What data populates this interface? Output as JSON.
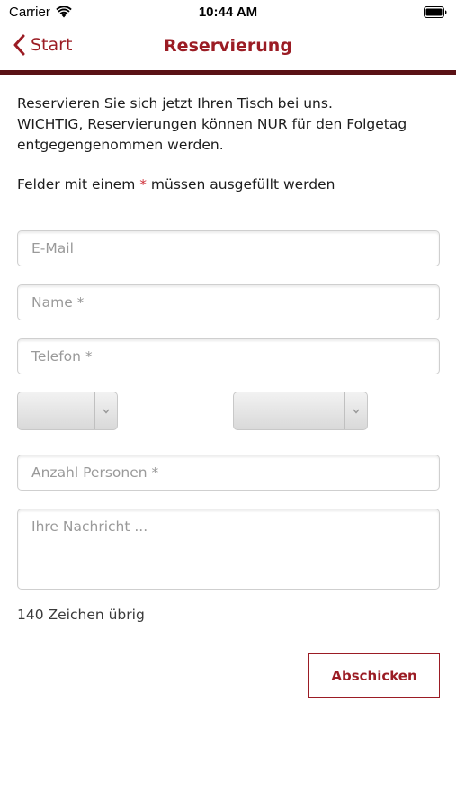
{
  "status_bar": {
    "carrier": "Carrier",
    "time": "10:44 AM"
  },
  "nav": {
    "back_label": "Start",
    "title": "Reservierung"
  },
  "content": {
    "intro_line1": "Reservieren Sie sich jetzt Ihren Tisch bei uns.",
    "intro_line2": "WICHTIG, Reservierungen können NUR für den Folgetag entgegengenommen werden.",
    "required_prefix": "Felder mit einem",
    "required_star": "*",
    "required_suffix": "müssen ausgefüllt werden"
  },
  "form": {
    "email_placeholder": "E-Mail",
    "name_placeholder": "Name *",
    "phone_placeholder": "Telefon *",
    "persons_placeholder": "Anzahl Personen *",
    "message_placeholder": "Ihre Nachricht ...",
    "char_count": "140 Zeichen übrig",
    "submit_label": "Abschicken"
  },
  "colors": {
    "accent": "#9b1c24",
    "divider": "#5a1215",
    "required_star": "#d0363f"
  },
  "icons": {
    "back": "chevron-left-icon",
    "wifi": "wifi-icon",
    "battery": "battery-icon",
    "dropdown": "chevron-down-icon"
  }
}
